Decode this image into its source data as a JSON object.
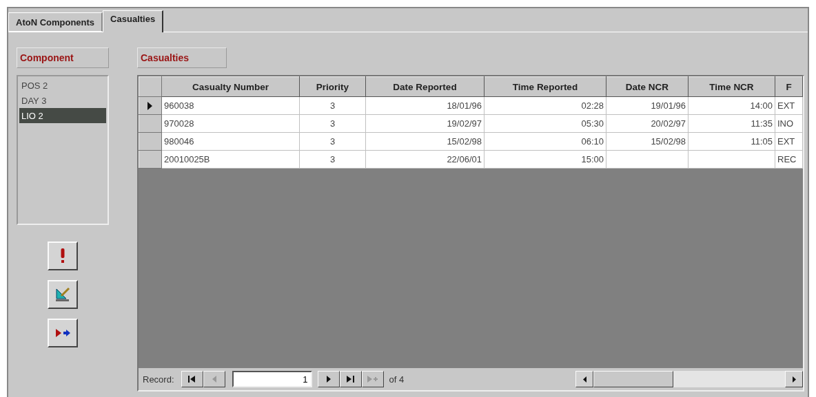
{
  "tabs": [
    {
      "label": "AtoN Components",
      "selected": false
    },
    {
      "label": "Casualties",
      "selected": true
    }
  ],
  "component_panel": {
    "label": "Component",
    "items": [
      {
        "label": "POS 2",
        "selected": false
      },
      {
        "label": "DAY 3",
        "selected": false
      },
      {
        "label": "LIO 2",
        "selected": true
      }
    ]
  },
  "action_buttons": [
    {
      "kind": "alert"
    },
    {
      "kind": "edit"
    },
    {
      "kind": "goto"
    }
  ],
  "casualties": {
    "label": "Casualties",
    "columns": [
      "Casualty Number",
      "Priority",
      "Date Reported",
      "Time Reported",
      "Date NCR",
      "Time NCR",
      "F"
    ],
    "rows": [
      {
        "selected": true,
        "cells": [
          "960038",
          "3",
          "18/01/96",
          "02:28",
          "19/01/96",
          "14:00",
          "EXT"
        ]
      },
      {
        "selected": false,
        "cells": [
          "970028",
          "3",
          "19/02/97",
          "05:30",
          "20/02/97",
          "11:35",
          "INO"
        ]
      },
      {
        "selected": false,
        "cells": [
          "980046",
          "3",
          "15/02/98",
          "06:10",
          "15/02/98",
          "11:05",
          "EXT"
        ]
      },
      {
        "selected": false,
        "cells": [
          "20010025B",
          "3",
          "22/06/01",
          "15:00",
          "",
          "",
          "REC"
        ]
      }
    ]
  },
  "navigation": {
    "label": "Record:",
    "value": "1",
    "total": "of 4",
    "buttons": [
      {
        "kind": "first",
        "disabled": false
      },
      {
        "kind": "prev",
        "disabled": true
      },
      {
        "kind": "next",
        "disabled": false
      },
      {
        "kind": "last",
        "disabled": false
      },
      {
        "kind": "new",
        "disabled": true
      }
    ]
  }
}
